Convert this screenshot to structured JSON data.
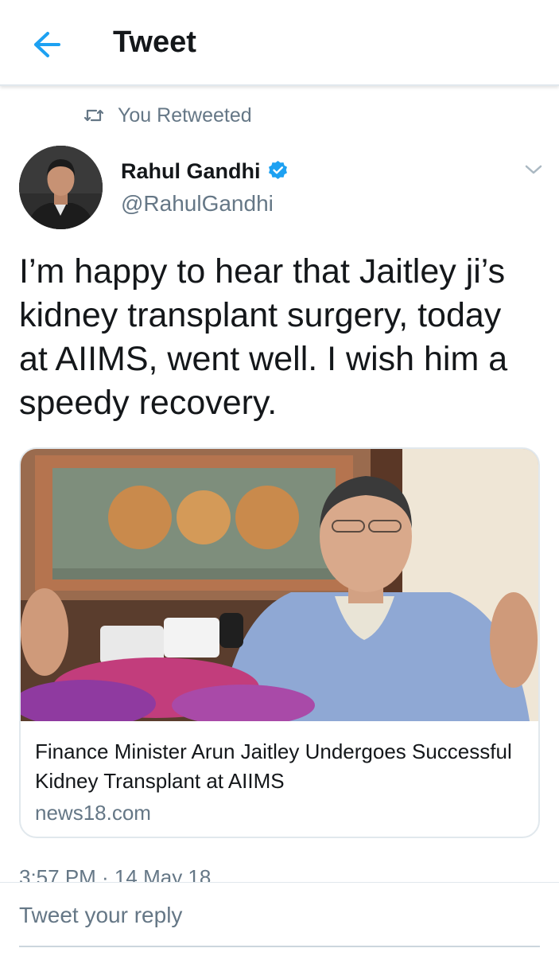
{
  "header": {
    "title": "Tweet",
    "back_icon": "arrow-left-icon",
    "accent": "#1da1f2"
  },
  "retweet": {
    "text": "You Retweeted",
    "icon": "retweet-icon"
  },
  "author": {
    "name": "Rahul Gandhi",
    "handle": "@RahulGandhi",
    "verified": true,
    "verified_icon": "verified-badge-icon"
  },
  "tweet": {
    "text": "I’m happy to hear that Jaitley ji’s kidney transplant surgery, today at AIIMS, went well. I wish him a speedy recovery."
  },
  "card": {
    "title": "Finance Minister Arun Jaitley Undergoes Successful Kidney Transplant at AIIMS",
    "domain": "news18.com"
  },
  "meta": {
    "timestamp": "3:57 PM · 14 May 18"
  },
  "reply": {
    "placeholder": "Tweet your reply"
  }
}
